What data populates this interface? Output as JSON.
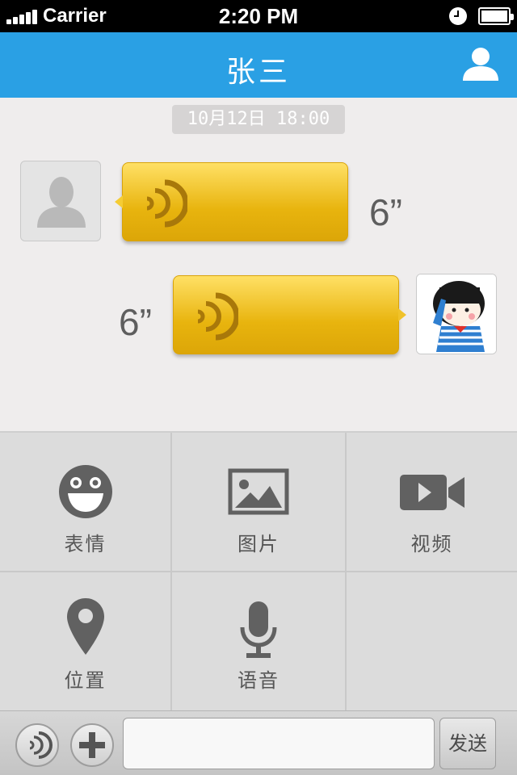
{
  "status_bar": {
    "carrier": "Carrier",
    "time": "2:20 PM"
  },
  "nav": {
    "title": "张三",
    "profile_icon": "person-icon"
  },
  "chat": {
    "timestamp": "10月12日 18:00",
    "messages": [
      {
        "side": "left",
        "type": "voice",
        "duration": "6”"
      },
      {
        "side": "right",
        "type": "voice",
        "duration": "6”"
      }
    ]
  },
  "panel": {
    "items": [
      {
        "label": "表情",
        "icon": "smiley-icon"
      },
      {
        "label": "图片",
        "icon": "image-icon"
      },
      {
        "label": "视频",
        "icon": "video-camera-icon"
      },
      {
        "label": "位置",
        "icon": "location-pin-icon"
      },
      {
        "label": "语音",
        "icon": "microphone-icon"
      }
    ]
  },
  "input_bar": {
    "value": "",
    "send_label": "发送"
  },
  "colors": {
    "nav": "#2aa0e4",
    "bubble": "#f5c21f",
    "panel": "#dcdcdc"
  }
}
